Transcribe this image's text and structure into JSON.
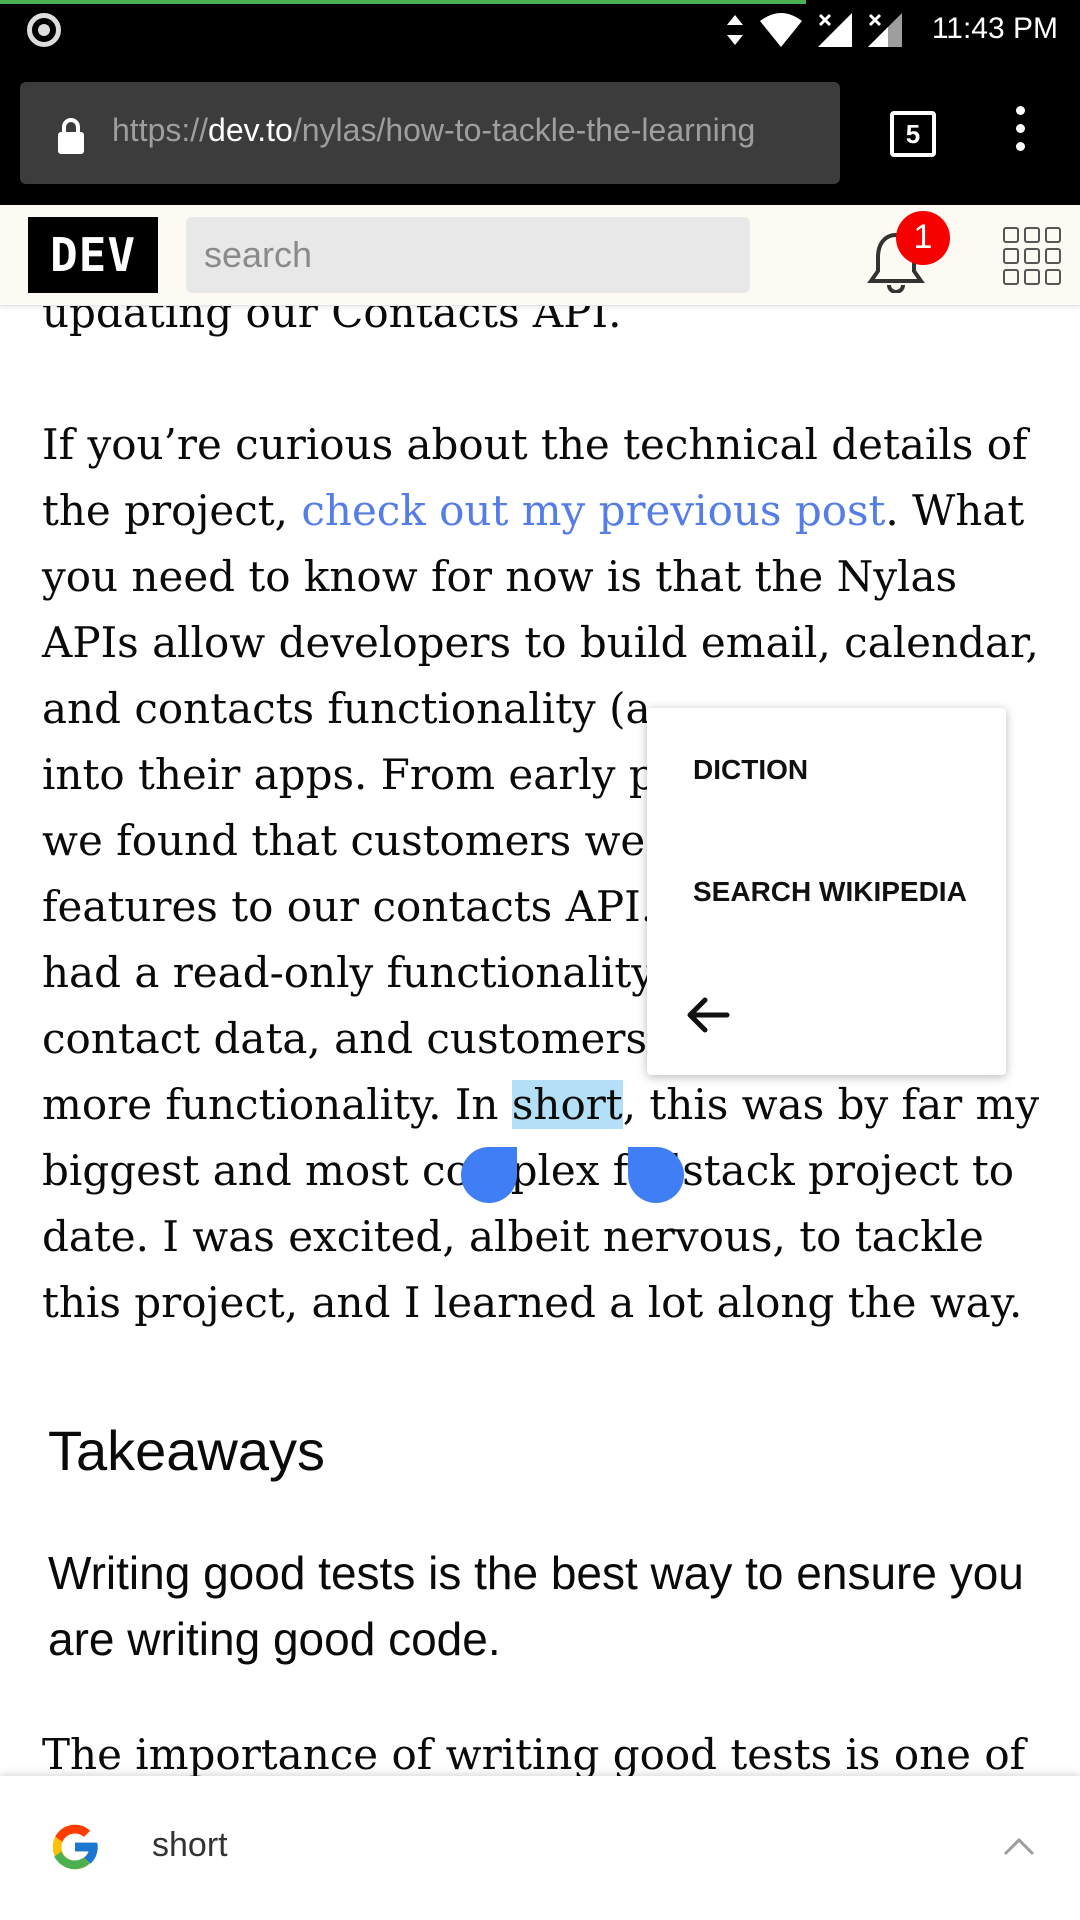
{
  "status_bar": {
    "time": "11:43 PM",
    "icons": [
      "record-icon",
      "data-arrows-icon",
      "wifi-icon",
      "signal-icon",
      "signal-icon"
    ]
  },
  "browser": {
    "url_scheme": "https://",
    "url_host": "dev.to",
    "url_path": "/nylas/how-to-tackle-the-learning",
    "tab_count": "5"
  },
  "site_header": {
    "logo": "DEV",
    "search_placeholder": "search",
    "notification_count": "1"
  },
  "article": {
    "line_0": "updating our Contacts API.",
    "para2_prefix": "If you’re curious about the technical details of",
    "para2_line2_start": "the project, ",
    "link_text": "check out my previous post",
    "para2_line2_end": ". What",
    "lines": [
      "you need to know for now is that the Nylas",
      "APIs allow developers to build email, calendar,",
      "and contacts functionality (a",
      "into their apps. From early p",
      "we found that customers we",
      "features to our contacts API.",
      "had a read-only functionality",
      "contact data, and customers"
    ],
    "line_sel_before": "more functionality. In ",
    "selected_word": "short",
    "line_sel_after": ", this was by far my",
    "lines_after": [
      "biggest and most complex fullstack project to",
      "date. I was excited, albeit nervous, to tackle",
      "this project, and I learned a lot along the way."
    ],
    "heading": "Takeaways",
    "subheading": "Writing good tests is the best way to ensure you are writing good code.",
    "next_para": "The importance of writing good tests is one of"
  },
  "context_menu": {
    "items": [
      "DICTION",
      "SEARCH WIKIPEDIA"
    ]
  },
  "google_bar": {
    "query": "short"
  },
  "colors": {
    "link": "#557de8",
    "selection": "#b3e0f6",
    "handle": "#3f7ef5",
    "badge": "#f60000"
  }
}
